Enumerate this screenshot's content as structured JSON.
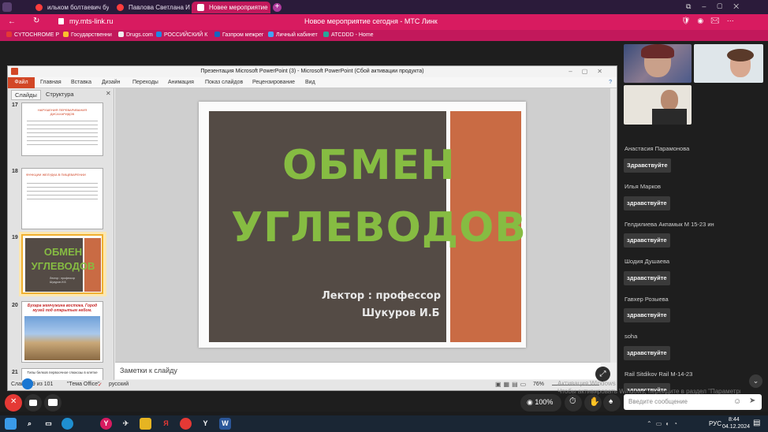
{
  "browser": {
    "tabs": [
      {
        "label": "ильком болтаевич бухар"
      },
      {
        "label": "Павлова Светлана Иванс"
      },
      {
        "label": "Новее мероприятие"
      }
    ],
    "url": "my.mts-link.ru",
    "page_title": "Новое мероприятие сегодня - МТС Линк",
    "bookmarks": [
      "CYTOCHROME P",
      "Государственни",
      "Drugs.com",
      "РОССИЙСКИЙ К",
      "Газпром межрег",
      "Личный кабинет",
      "ATCDDD - Home"
    ],
    "accent": "#d81b60"
  },
  "ppt": {
    "window_title": "Презентация Microsoft PowerPoint (3)  -  Microsoft PowerPoint (Сбой активации продукта)",
    "ribbon_tabs": [
      "Файл",
      "Главная",
      "Вставка",
      "Дизайн",
      "Переходы",
      "Анимация",
      "Показ слайдов",
      "Рецензирование",
      "Вид"
    ],
    "panel_tabs": [
      "Слайды",
      "Структура"
    ],
    "thumbnails": [
      {
        "num": "17",
        "title": "НАРУШЕНИЯ ПЕРЕВАРИВАНИЯ ДИСАХАРИДОВ"
      },
      {
        "num": "18",
        "title": "ФУНКЦИИ ЖЕЛУДКА В ПИЩЕВАРЕНИИ"
      },
      {
        "num": "19",
        "title": "ОБМЕН УГЛЕВОДОВ",
        "sub": "Лектор : профессор Шукуров И.Б"
      },
      {
        "num": "20",
        "title": "Бухара жемчужина востока. Город музей под открытым небом."
      },
      {
        "num": "21",
        "title": "Типы белков первоочное глюкозы в клетке"
      }
    ],
    "slide": {
      "title_line1": "ОБМЕН",
      "title_line2": "УГЛЕВОДОВ",
      "sub_line1": "Лектор : профессор",
      "sub_line2": "Шукуров И.Б"
    },
    "notes_placeholder": "Заметки к слайду",
    "status": {
      "slide": "Слайд 19 из 101",
      "theme": "\"Тема Office\"",
      "lang": "русский",
      "zoom": "76%"
    }
  },
  "participants": [
    {
      "name": "Анастасия Парамонова",
      "msg": "Здравствуйте"
    },
    {
      "name": "Илья Марков",
      "msg": "здравствуйте"
    },
    {
      "name": "Гелдилиева Акпамык М 15-23 ин",
      "msg": "здравствуйте"
    },
    {
      "name": "Шодия Душаева",
      "msg": "здравствуйте"
    },
    {
      "name": "Гавхер Розыева",
      "msg": "здравствуйте"
    },
    {
      "name": "soha",
      "msg": "здравствуйте"
    },
    {
      "name": "Rail Sitdikov Rail M-14-23",
      "msg": "здравствуйте"
    }
  ],
  "controls": {
    "volume": "100%",
    "message_placeholder": "Введите сообщение"
  },
  "watermark": {
    "line1": "Активация Windows",
    "line2": "Чтобы активировать Windows, перейдите в раздел \"Параметры\"."
  },
  "taskbar": {
    "lang": "РУС",
    "time": "8:44",
    "date": "04.12.2024"
  }
}
